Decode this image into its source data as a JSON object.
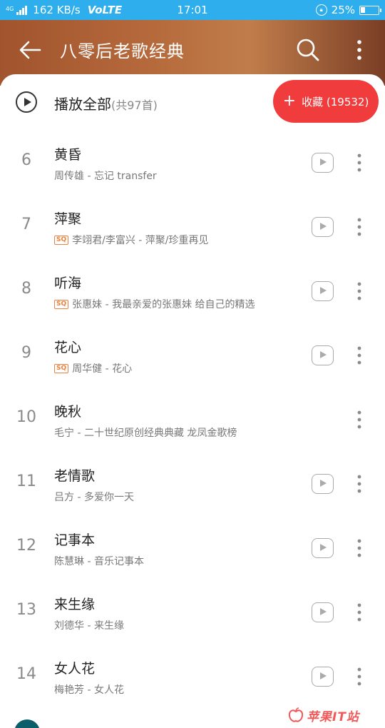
{
  "status_bar": {
    "network": "4G",
    "speed": "162 KB/s",
    "volte": "VoLTE",
    "time": "17:01",
    "battery": "25%"
  },
  "header": {
    "title": "八零后老歌经典",
    "back_icon": "arrow-left-icon",
    "search_icon": "search-icon",
    "more_icon": "more-vertical-icon",
    "gradient": [
      "#a1542d",
      "#c07d4b",
      "#7a3e25"
    ]
  },
  "play_all": {
    "label": "播放全部",
    "count": "(共97首)"
  },
  "favorite": {
    "plus": "+",
    "label": "收藏 (19532)",
    "color": "#f03c3c"
  },
  "songs": [
    {
      "num": "6",
      "title": "黄昏",
      "sq": false,
      "subtitle": "周传雄 - 忘记 transfer",
      "mv": true
    },
    {
      "num": "7",
      "title": "萍聚",
      "sq": true,
      "subtitle": "李翊君/李富兴 - 萍聚/珍重再见",
      "mv": true
    },
    {
      "num": "8",
      "title": "听海",
      "sq": true,
      "subtitle": "张惠妹 - 我最亲爱的张惠妹 给自己的精选",
      "mv": true
    },
    {
      "num": "9",
      "title": "花心",
      "sq": true,
      "subtitle": "周华健 - 花心",
      "mv": true
    },
    {
      "num": "10",
      "title": "晚秋",
      "sq": false,
      "subtitle": "毛宁 - 二十世纪原创经典典藏 龙凤金歌榜",
      "mv": false
    },
    {
      "num": "11",
      "title": "老情歌",
      "sq": false,
      "subtitle": "吕方 - 多爱你一天",
      "mv": true
    },
    {
      "num": "12",
      "title": "记事本",
      "sq": false,
      "subtitle": "陈慧琳 - 音乐记事本",
      "mv": true
    },
    {
      "num": "13",
      "title": "来生缘",
      "sq": false,
      "subtitle": "刘德华 - 来生缘",
      "mv": true
    },
    {
      "num": "14",
      "title": "女人花",
      "sq": false,
      "subtitle": "梅艳芳 - 女人花",
      "mv": true
    }
  ],
  "sq_badge": "SQ",
  "watermark": "苹果IT站",
  "accent_colors": {
    "status_bar": "#2eaeec",
    "sq_badge": "#e8823e",
    "watermark": "#f25a5a"
  }
}
